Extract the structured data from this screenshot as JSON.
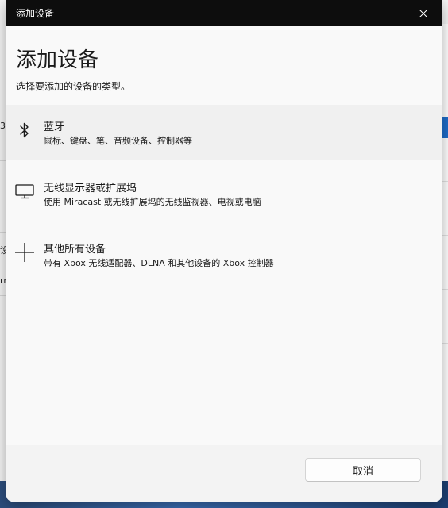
{
  "dialog": {
    "window_title": "添加设备",
    "heading": "添加设备",
    "subheading": "选择要添加的设备的类型。",
    "options": [
      {
        "name": "蓝牙",
        "description": "鼠标、键盘、笔、音频设备、控制器等",
        "icon": "bluetooth-icon"
      },
      {
        "name": "无线显示器或扩展坞",
        "description": "使用 Miracast 或无线扩展坞的无线监视器、电视或电脑",
        "icon": "monitor-icon"
      },
      {
        "name": "其他所有设备",
        "description": "带有 Xbox 无线适配器、DLNA 和其他设备的 Xbox 控制器",
        "icon": "plus-icon"
      }
    ],
    "cancel_label": "取消",
    "close_icon": "close-icon"
  },
  "background": {
    "left_fragments": [
      "3",
      "设",
      "rr"
    ]
  },
  "colors": {
    "titlebar": "#0d0d0d",
    "dialog_bg": "#f9f9f9",
    "hover_bg": "#f0f0f0",
    "accent": "#1f6cc8"
  }
}
